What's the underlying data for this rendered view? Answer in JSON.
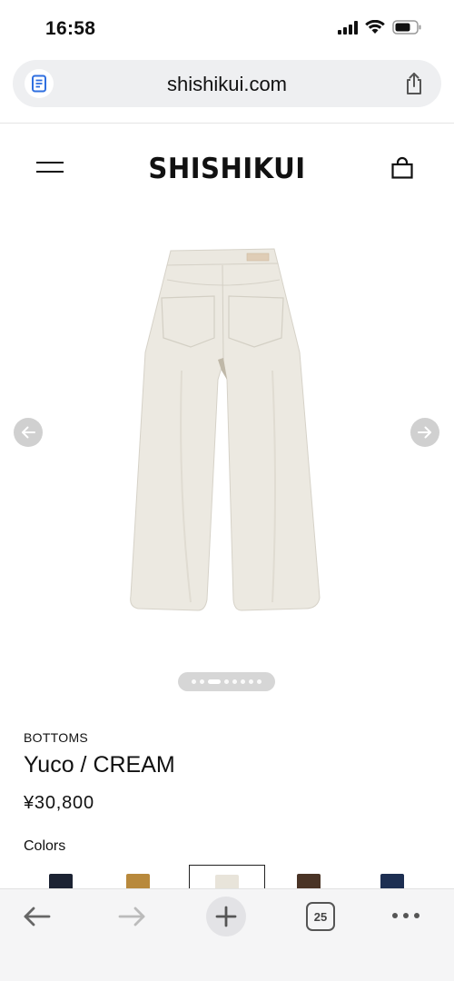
{
  "status_bar": {
    "time": "16:58"
  },
  "browser": {
    "url": "shishikui.com",
    "tab_count": "25"
  },
  "site": {
    "brand": "SHISHIKUI"
  },
  "carousel": {
    "image_count": 8,
    "active_index": 2
  },
  "product": {
    "category": "BOTTOMS",
    "name": "Yuco / CREAM",
    "price": "¥30,800",
    "colors_label": "Colors",
    "swatches": [
      {
        "color": "#1c2333",
        "selected": false
      },
      {
        "color": "#b8893c",
        "selected": false
      },
      {
        "color": "#e8e4da",
        "selected": true
      },
      {
        "color": "#4a3426",
        "selected": false
      },
      {
        "color": "#1d2f52",
        "selected": false
      }
    ]
  },
  "colors": {
    "pants_fill": "#ece9e1",
    "pants_shade": "#d9d5cb",
    "arrow_bg": "#d0d0d0"
  }
}
